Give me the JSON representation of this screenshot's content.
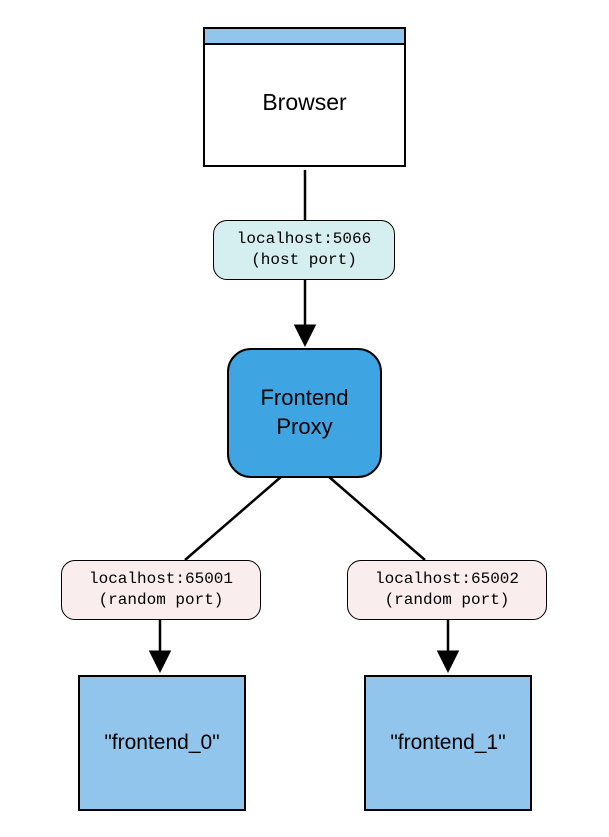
{
  "nodes": {
    "browser": {
      "label": "Browser"
    },
    "proxy": {
      "line1": "Frontend",
      "line2": "Proxy"
    },
    "frontend0": {
      "label": "\"frontend_0\""
    },
    "frontend1": {
      "label": "\"frontend_1\""
    }
  },
  "edges": {
    "host_port": {
      "line1": "localhost:5066",
      "line2": "(host port)"
    },
    "random_port_left": {
      "line1": "localhost:65001",
      "line2": "(random port)"
    },
    "random_port_right": {
      "line1": "localhost:65002",
      "line2": "(random port)"
    }
  }
}
